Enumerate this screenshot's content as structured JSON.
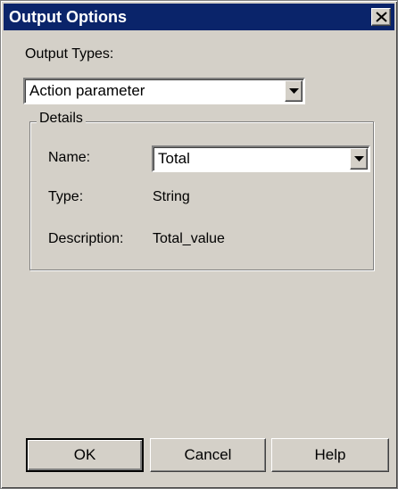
{
  "dialog": {
    "title": "Output Options"
  },
  "output_types": {
    "label": "Output Types:",
    "selected": "Action parameter"
  },
  "details": {
    "group_label": "Details",
    "name_label": "Name:",
    "name_value": "Total",
    "type_label": "Type:",
    "type_value": "String",
    "description_label": "Description:",
    "description_value": "Total_value"
  },
  "buttons": {
    "ok": "OK",
    "cancel": "Cancel",
    "help": "Help"
  },
  "colors": {
    "titlebar": "#0a246a",
    "face": "#d4d0c8"
  },
  "icons": {
    "close": "close-icon",
    "dropdown": "chevron-down-icon"
  }
}
